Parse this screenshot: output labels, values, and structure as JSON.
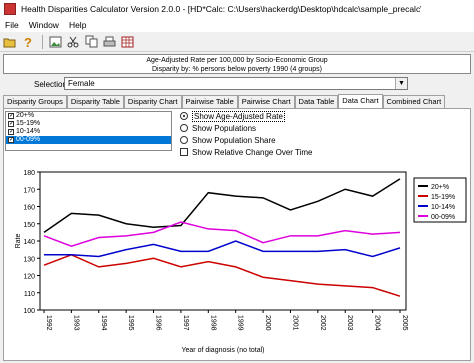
{
  "window": {
    "title": "Health Disparities Calculator Version 2.0.0 - [HD*Calc: C:\\Users\\hackerdg\\Desktop\\hdcalc\\sample_precalc\\he..."
  },
  "menu": [
    "File",
    "Window",
    "Help"
  ],
  "toolbar": {
    "icons": [
      "open-folder-icon",
      "help-icon",
      "image-icon",
      "cut-icon",
      "copy-icon",
      "print-icon",
      "grid-icon"
    ]
  },
  "header": {
    "line1": "Age-Adjusted Rate per 100,000 by Socio-Economic Group",
    "line2": "Disparity by: % persons below poverty 1990 (4 groups)"
  },
  "selection": {
    "label": "Selection:",
    "value": "Female"
  },
  "tabs": [
    {
      "label": "Disparity Groups",
      "active": false
    },
    {
      "label": "Disparity Table",
      "active": false
    },
    {
      "label": "Disparity Chart",
      "active": false
    },
    {
      "label": "Pairwise Table",
      "active": false
    },
    {
      "label": "Pairwise Chart",
      "active": false
    },
    {
      "label": "Data Table",
      "active": false
    },
    {
      "label": "Data Chart",
      "active": true
    },
    {
      "label": "Combined Chart",
      "active": false
    }
  ],
  "groups": [
    {
      "label": "20+%",
      "checked": true,
      "selected": false
    },
    {
      "label": "15-19%",
      "checked": true,
      "selected": false
    },
    {
      "label": "10-14%",
      "checked": true,
      "selected": false
    },
    {
      "label": "00-09%",
      "checked": true,
      "selected": true
    }
  ],
  "options": {
    "radios": [
      {
        "label": "Show Age-Adjusted Rate",
        "checked": true
      },
      {
        "label": "Show Populations",
        "checked": false
      },
      {
        "label": "Show Population Share",
        "checked": false
      }
    ],
    "checkbox": {
      "label": "Show Relative Change Over Time",
      "checked": false
    }
  },
  "chart_data": {
    "type": "line",
    "xlabel": "Year of diagnosis (no total)",
    "ylabel": "Rate",
    "ylim": [
      100,
      180
    ],
    "yticks": [
      100,
      110,
      120,
      130,
      140,
      150,
      160,
      170,
      180
    ],
    "x": [
      "1992",
      "1993",
      "1994",
      "1995",
      "1996",
      "1997",
      "1998",
      "1999",
      "2000",
      "2001",
      "2002",
      "2003",
      "2004",
      "2005"
    ],
    "grid": false,
    "legend_position": "top-right",
    "series": [
      {
        "name": "20+%",
        "color": "#000000",
        "values": [
          145,
          156,
          155,
          150,
          148,
          149,
          168,
          166,
          165,
          158,
          163,
          170,
          166,
          176
        ]
      },
      {
        "name": "15-19%",
        "color": "#cc0000",
        "values": [
          126,
          132,
          125,
          127,
          130,
          125,
          128,
          125,
          119,
          117,
          115,
          114,
          113,
          108
        ]
      },
      {
        "name": "10-14%",
        "color": "#0000cc",
        "values": [
          132,
          132,
          131,
          135,
          138,
          134,
          134,
          140,
          134,
          134,
          134,
          135,
          131,
          136
        ]
      },
      {
        "name": "00-09%",
        "color": "#dd00dd",
        "values": [
          143,
          137,
          142,
          143,
          145,
          151,
          147,
          146,
          139,
          143,
          143,
          146,
          144,
          145
        ]
      }
    ]
  }
}
